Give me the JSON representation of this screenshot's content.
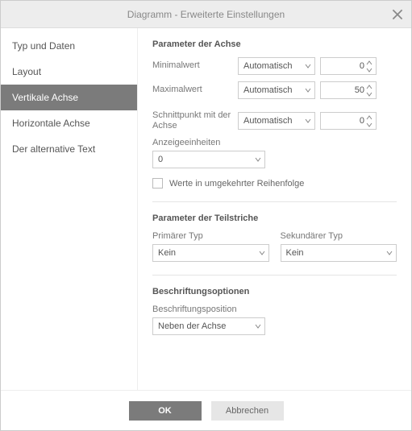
{
  "title": "Diagramm - Erweiterte Einstellungen",
  "sidebar": {
    "items": [
      {
        "label": "Typ und Daten"
      },
      {
        "label": "Layout"
      },
      {
        "label": "Vertikale Achse"
      },
      {
        "label": "Horizontale Achse"
      },
      {
        "label": "Der alternative Text"
      }
    ]
  },
  "content": {
    "axis_params_title": "Parameter der Achse",
    "min_label": "Minimalwert",
    "min_mode": "Automatisch",
    "min_value": "0",
    "max_label": "Maximalwert",
    "max_mode": "Automatisch",
    "max_value": "50",
    "cross_label": "Schnittpunkt mit der Achse",
    "cross_mode": "Automatisch",
    "cross_value": "0",
    "display_units_label": "Anzeigeeinheiten",
    "display_units_value": "0",
    "reverse_label": "Werte in umgekehrter Reihenfolge",
    "tick_params_title": "Parameter der Teilstriche",
    "primary_type_label": "Primärer Typ",
    "primary_type_value": "Kein",
    "secondary_type_label": "Sekundärer Typ",
    "secondary_type_value": "Kein",
    "label_options_title": "Beschriftungsoptionen",
    "label_position_label": "Beschriftungsposition",
    "label_position_value": "Neben der Achse"
  },
  "footer": {
    "ok": "OK",
    "cancel": "Abbrechen"
  }
}
